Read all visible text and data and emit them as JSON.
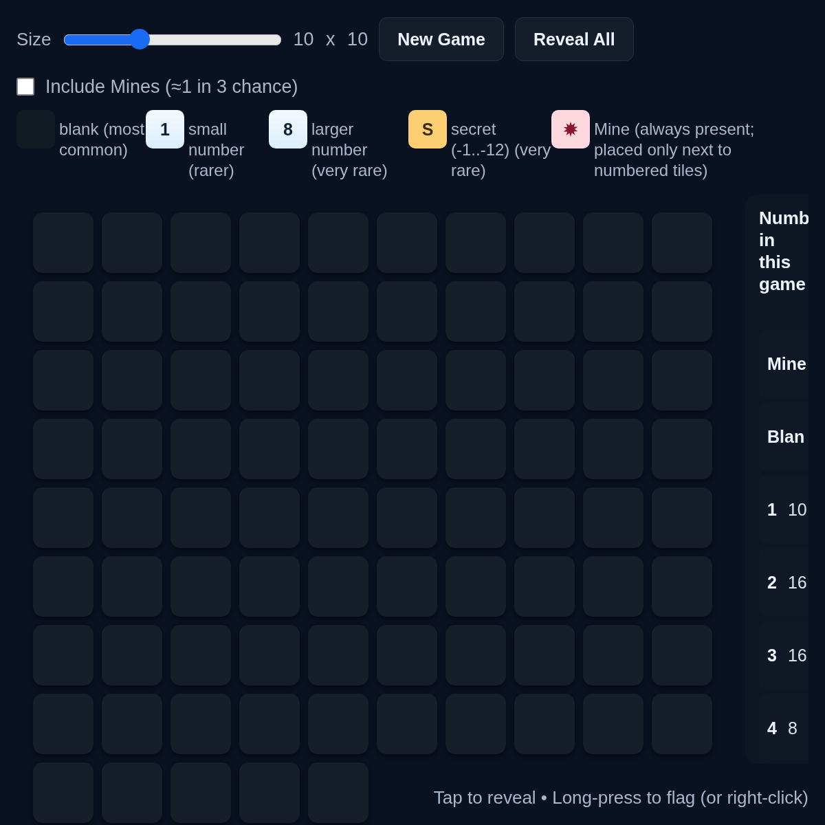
{
  "controls": {
    "size_label": "Size",
    "size_slider": {
      "level": 0.35
    },
    "size_readout": "10 x 10",
    "buttons": [
      "New Game",
      "Reveal All"
    ]
  },
  "include_mines": {
    "label": "Include Mines (≈1 in 3 chance)",
    "checked": false
  },
  "legend": [
    {
      "kind": "blank",
      "text": "blank (most common)"
    },
    {
      "kind": "number",
      "swatch": "1",
      "text": "small number (rarer)"
    },
    {
      "kind": "number",
      "swatch": "8",
      "text": "larger number (very rare)"
    },
    {
      "kind": "secret",
      "swatch": "S",
      "text": "secret (-1..-12) (very rare)"
    },
    {
      "kind": "mine",
      "text": "Mine (always present; placed only next to numbered tiles)"
    }
  ],
  "board": {
    "rows": [
      [
        {
          "revealed": false
        },
        {
          "revealed": false
        },
        {
          "revealed": false
        },
        {
          "revealed": false
        },
        {
          "revealed": false
        },
        {
          "revealed": false
        },
        {
          "revealed": false
        },
        {
          "revealed": false
        },
        {
          "revealed": false
        },
        {
          "revealed": false
        }
      ],
      [
        {
          "revealed": false
        },
        {
          "revealed": false
        },
        {
          "revealed": false
        },
        {
          "revealed": false
        },
        {
          "revealed": false
        },
        {
          "revealed": false
        },
        {
          "revealed": false
        },
        {
          "revealed": false
        },
        {
          "revealed": false
        },
        {
          "revealed": false
        }
      ],
      [
        {
          "revealed": false
        },
        {
          "revealed": false
        },
        {
          "revealed": false
        },
        {
          "revealed": false
        },
        {
          "revealed": false
        },
        {
          "revealed": false
        },
        {
          "revealed": false
        },
        {
          "revealed": false
        },
        {
          "revealed": false
        },
        {
          "revealed": false
        }
      ],
      [
        {
          "revealed": false
        },
        {
          "revealed": false
        },
        {
          "revealed": false
        },
        {
          "revealed": false
        },
        {
          "revealed": false
        },
        {
          "revealed": false
        },
        {
          "revealed": false
        },
        {
          "revealed": false
        },
        {
          "revealed": false
        },
        {
          "revealed": false
        }
      ],
      [
        {
          "revealed": false
        },
        {
          "revealed": false
        },
        {
          "revealed": false
        },
        {
          "revealed": false
        },
        {
          "revealed": false
        },
        {
          "revealed": false
        },
        {
          "revealed": false
        },
        {
          "revealed": false
        },
        {
          "revealed": false
        },
        {
          "revealed": false
        }
      ],
      [
        {
          "revealed": false
        },
        {
          "revealed": false
        },
        {
          "revealed": false
        },
        {
          "revealed": false
        },
        {
          "revealed": false
        },
        {
          "revealed": false
        },
        {
          "revealed": false
        },
        {
          "revealed": false
        },
        {
          "revealed": false
        },
        {
          "revealed": false
        }
      ],
      [
        {
          "revealed": false
        },
        {
          "revealed": false
        },
        {
          "revealed": false
        },
        {
          "revealed": false
        },
        {
          "revealed": false
        },
        {
          "revealed": false
        },
        {
          "revealed": false
        },
        {
          "revealed": false
        },
        {
          "revealed": false
        },
        {
          "revealed": false
        }
      ],
      [
        {
          "revealed": false
        },
        {
          "revealed": false
        },
        {
          "revealed": false
        },
        {
          "revealed": false
        },
        {
          "revealed": false
        },
        {
          "revealed": false
        },
        {
          "revealed": false
        },
        {
          "revealed": false
        },
        {
          "revealed": false
        },
        {
          "revealed": false
        }
      ],
      [
        {
          "revealed": false
        },
        {
          "revealed": false
        },
        {
          "revealed": false
        },
        {
          "revealed": false
        },
        {
          "revealed": false
        }
      ]
    ]
  },
  "stats_panel": {
    "heading": "Numb in this game",
    "rows": [
      {
        "label": "Mine"
      },
      {
        "label": "Blan"
      },
      {
        "label": "1",
        "value": "10"
      },
      {
        "label": "2",
        "value": "16"
      },
      {
        "label": "3",
        "value": "16"
      },
      {
        "label": "4",
        "value": "8"
      }
    ]
  },
  "hint": "Tap to reveal • Long-press to flag (or right-click)"
}
